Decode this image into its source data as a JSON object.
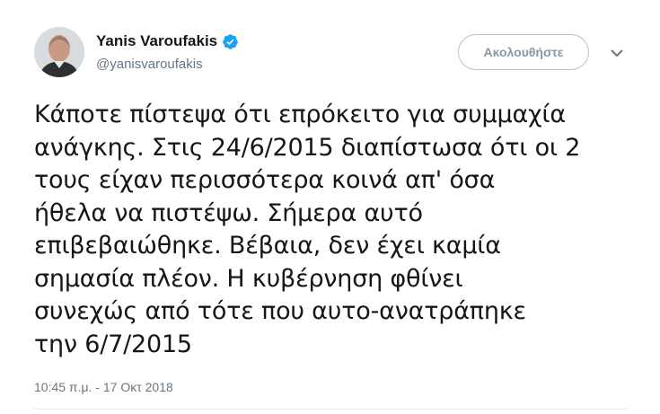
{
  "tweet": {
    "author": {
      "display_name": "Yanis Varoufakis",
      "handle": "@yanisvaroufakis",
      "verified": true,
      "verified_color": "#1da1f2"
    },
    "follow_label": "Ακολουθήστε",
    "text_lines": [
      "Κάποτε πίστεψα ότι επρόκειτο για συμμαχία",
      "ανάγκης. Στις 24/6/2015 διαπίστωσα ότι οι 2",
      "τους είχαν περισσότερα κοινά απ' όσα",
      "ήθελα να πιστέψω. Σήμερα αυτό",
      "επιβεβαιώθηκε. Βέβαια, δεν έχει καμία",
      "σημασία πλέον. Η κυβέρνηση φθίνει",
      "συνεχώς από τότε που αυτο-ανατράπηκε",
      "την 6/7/2015"
    ],
    "timestamp": "10:45 π.μ. - 17 Οκτ 2018"
  },
  "icons": {
    "verified": "verified-badge-icon",
    "menu": "chevron-down-icon"
  }
}
